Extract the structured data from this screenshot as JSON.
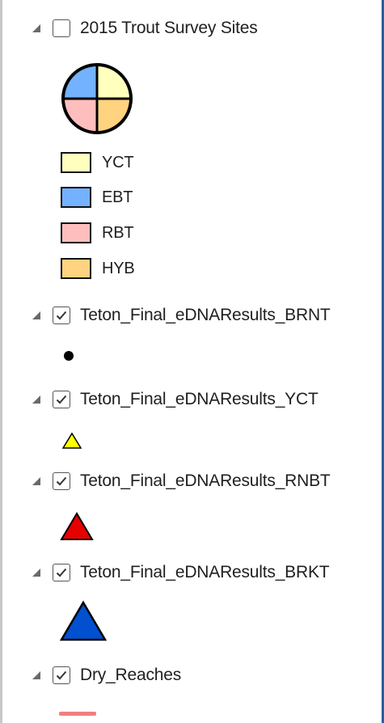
{
  "layers": [
    {
      "name": "2015 Trout Survey Sites",
      "checked": false,
      "expanded": true
    },
    {
      "name": "Teton_Final_eDNAResults_BRNT",
      "checked": true,
      "expanded": true
    },
    {
      "name": "Teton_Final_eDNAResults_YCT",
      "checked": true,
      "expanded": true
    },
    {
      "name": "Teton_Final_eDNAResults_RNBT",
      "checked": true,
      "expanded": true
    },
    {
      "name": "Teton_Final_eDNAResults_BRKT",
      "checked": true,
      "expanded": true
    },
    {
      "name": "Dry_Reaches",
      "checked": true,
      "expanded": true
    }
  ],
  "trout_legend": [
    {
      "label": "YCT",
      "color": "#FFFFBE"
    },
    {
      "label": "EBT",
      "color": "#73B2FF"
    },
    {
      "label": "RBT",
      "color": "#FFBEBE"
    },
    {
      "label": "HYB",
      "color": "#FFD37F"
    }
  ],
  "symbol_colors": {
    "brnt_point": "#000000",
    "yct_triangle": "#FFFF00",
    "rnbt_triangle": "#E60000",
    "brkt_triangle": "#0050D0",
    "dry_reaches_line": "#F08080",
    "pie_outline": "#000000"
  }
}
